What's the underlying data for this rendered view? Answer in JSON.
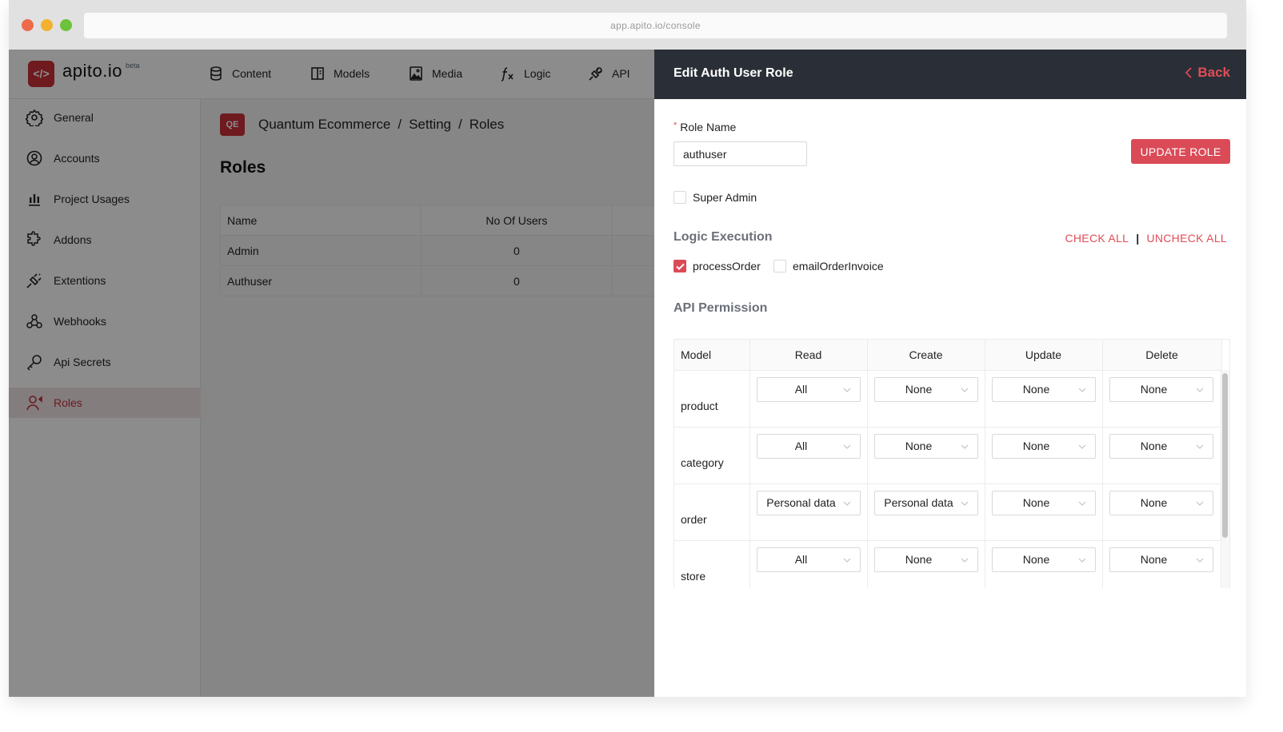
{
  "browser": {
    "url": "app.apito.io/console"
  },
  "app": {
    "logo_glyph": "</>",
    "logo_text": "apito.io",
    "logo_badge": "beta",
    "topnav": [
      {
        "label": "Content",
        "icon": "database-icon"
      },
      {
        "label": "Models",
        "icon": "models-icon"
      },
      {
        "label": "Media",
        "icon": "media-icon"
      },
      {
        "label": "Logic",
        "icon": "function-icon"
      },
      {
        "label": "API",
        "icon": "plug-icon"
      }
    ],
    "sidebar": [
      {
        "label": "General",
        "icon": "gear-icon"
      },
      {
        "label": "Accounts",
        "icon": "user-circle-icon"
      },
      {
        "label": "Project Usages",
        "icon": "bar-chart-icon"
      },
      {
        "label": "Addons",
        "icon": "puzzle-icon"
      },
      {
        "label": "Extentions",
        "icon": "plug-icon"
      },
      {
        "label": "Webhooks",
        "icon": "webhook-icon"
      },
      {
        "label": "Api Secrets",
        "icon": "key-icon"
      },
      {
        "label": "Roles",
        "icon": "user-role-icon",
        "active": true
      }
    ],
    "project_badge": "QE",
    "breadcrumb": [
      "Quantum Ecommerce",
      "/",
      "Setting",
      "/",
      "Roles"
    ],
    "page_title": "Roles",
    "roles_table": {
      "headers": [
        "Name",
        "No Of Users"
      ],
      "rows": [
        [
          "Admin",
          "0"
        ],
        [
          "Authuser",
          "0"
        ]
      ]
    }
  },
  "drawer": {
    "title": "Edit Auth User Role",
    "back_label": "Back",
    "role_name_label": "Role Name",
    "role_name_required": "*",
    "role_name_value": "authuser",
    "update_button": "UPDATE ROLE",
    "super_admin_label": "Super Admin",
    "super_admin_checked": false,
    "logic_section_title": "Logic Execution",
    "check_all": "CHECK ALL",
    "separator": "|",
    "uncheck_all": "UNCHECK ALL",
    "logic_functions": [
      {
        "label": "processOrder",
        "checked": true
      },
      {
        "label": "emailOrderInvoice",
        "checked": false
      }
    ],
    "api_section_title": "API Permission",
    "permissions": {
      "headers": [
        "Model",
        "Read",
        "Create",
        "Update",
        "Delete"
      ],
      "rows": [
        {
          "model": "product",
          "read": "All",
          "create": "None",
          "update": "None",
          "delete": "None"
        },
        {
          "model": "category",
          "read": "All",
          "create": "None",
          "update": "None",
          "delete": "None"
        },
        {
          "model": "order",
          "read": "Personal data",
          "create": "Personal data",
          "update": "None",
          "delete": "None"
        },
        {
          "model": "store",
          "read": "All",
          "create": "None",
          "update": "None",
          "delete": "None"
        }
      ]
    }
  },
  "colors": {
    "accent": "#da4b57",
    "drawer_header": "#2a2f37",
    "brand": "#c9303a"
  }
}
